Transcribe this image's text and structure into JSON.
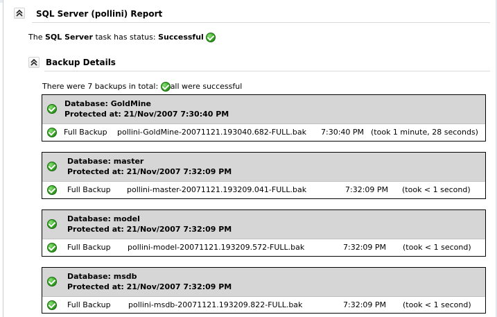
{
  "report": {
    "title": "SQL Server (pollini) Report"
  },
  "status": {
    "prefix": "The",
    "task_name": "SQL Server",
    "middle": "task has status:",
    "value": "Successful"
  },
  "backup_section": {
    "title": "Backup Details",
    "summary_before": "There were 7 backups in total:",
    "summary_after": "all were successful"
  },
  "databases": [
    {
      "name": "Database: GoldMine",
      "protected": "Protected at: 21/Nov/2007 7:30:40 PM",
      "type": "Full Backup",
      "file": "pollini-GoldMine-20071121.193040.682-FULL.bak",
      "time": "7:30:40 PM",
      "duration": "(took 1 minute, 28 seconds)"
    },
    {
      "name": "Database: master",
      "protected": "Protected at: 21/Nov/2007 7:32:09 PM",
      "type": "Full Backup",
      "file": "pollini-master-20071121.193209.041-FULL.bak",
      "time": "7:32:09 PM",
      "duration": "(took < 1 second)"
    },
    {
      "name": "Database: model",
      "protected": "Protected at: 21/Nov/2007 7:32:09 PM",
      "type": "Full Backup",
      "file": "pollini-model-20071121.193209.572-FULL.bak",
      "time": "7:32:09 PM",
      "duration": "(took < 1 second)"
    },
    {
      "name": "Database: msdb",
      "protected": "Protected at: 21/Nov/2007 7:32:09 PM",
      "type": "Full Backup",
      "file": "pollini-msdb-20071121.193209.822-FULL.bak",
      "time": "7:32:09 PM",
      "duration": "(took < 1 second)"
    }
  ],
  "icons": {
    "collapse": "double-chevron-up-icon",
    "success": "green-check-circle-icon"
  },
  "colors": {
    "success_green": "#3fae2a",
    "header_gray": "#d6d6d6"
  }
}
